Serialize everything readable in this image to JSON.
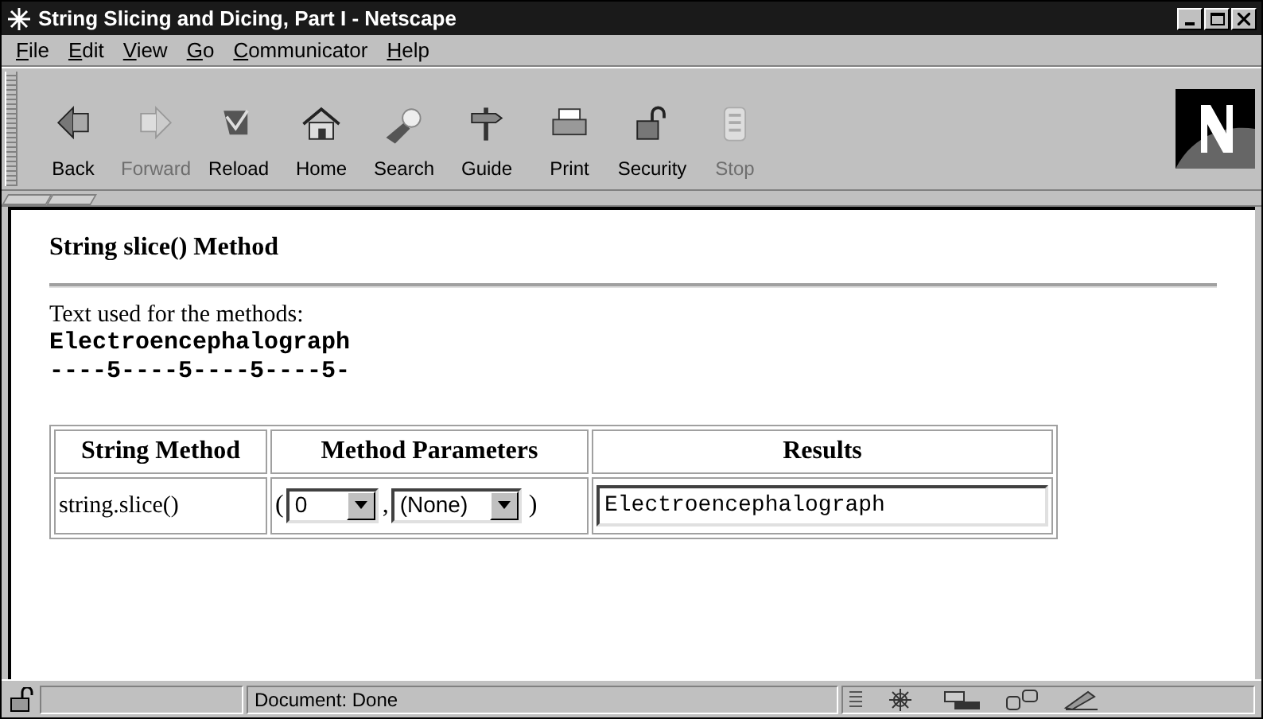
{
  "window": {
    "title": "String Slicing and Dicing, Part I - Netscape"
  },
  "menu": [
    "File",
    "Edit",
    "View",
    "Go",
    "Communicator",
    "Help"
  ],
  "toolbar": [
    {
      "label": "Back",
      "disabled": false
    },
    {
      "label": "Forward",
      "disabled": true
    },
    {
      "label": "Reload",
      "disabled": false
    },
    {
      "label": "Home",
      "disabled": false
    },
    {
      "label": "Search",
      "disabled": false
    },
    {
      "label": "Guide",
      "disabled": false
    },
    {
      "label": "Print",
      "disabled": false
    },
    {
      "label": "Security",
      "disabled": false
    },
    {
      "label": "Stop",
      "disabled": true
    }
  ],
  "page": {
    "heading": "String slice() Method",
    "intro": "Text used for the methods:",
    "sample": "Electroencephalograph",
    "ruler": "----5----5----5----5-",
    "table": {
      "columns": [
        "String Method",
        "Method Parameters",
        "Results"
      ],
      "rows": [
        {
          "method": "string.slice()",
          "open": "(",
          "start": "0",
          "sep": ",",
          "end": "(None)",
          "close": ")",
          "result": "Electroencephalograph"
        }
      ]
    }
  },
  "status_bar": {
    "message": "Document: Done"
  }
}
